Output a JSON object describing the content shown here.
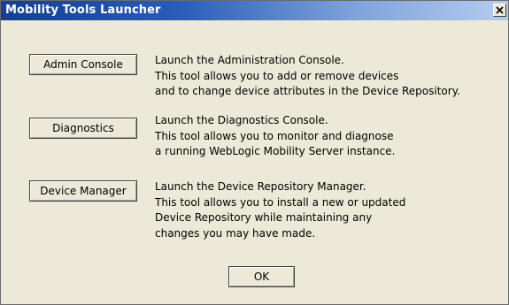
{
  "window": {
    "title": "Mobility Tools Launcher",
    "close_icon": "close-x-icon"
  },
  "tools": [
    {
      "button_label": "Admin Console",
      "description": [
        "Launch the Administration Console.",
        "This tool allows you to add or remove devices",
        "and to change device attributes in the Device Repository."
      ]
    },
    {
      "button_label": "Diagnostics",
      "description": [
        "Launch the Diagnostics Console.",
        "This tool allows you to monitor and diagnose",
        "a running WebLogic Mobility Server instance."
      ]
    },
    {
      "button_label": "Device Manager",
      "description": [
        "Launch the Device Repository Manager.",
        "This tool allows you to install a new or updated",
        "Device Repository while maintaining any",
        "changes you may have made."
      ]
    }
  ],
  "ok_label": "OK",
  "colors": {
    "titlebar_start": "#143f92",
    "titlebar_end": "#b5ccee",
    "dialog_background": "#ece9d8"
  }
}
